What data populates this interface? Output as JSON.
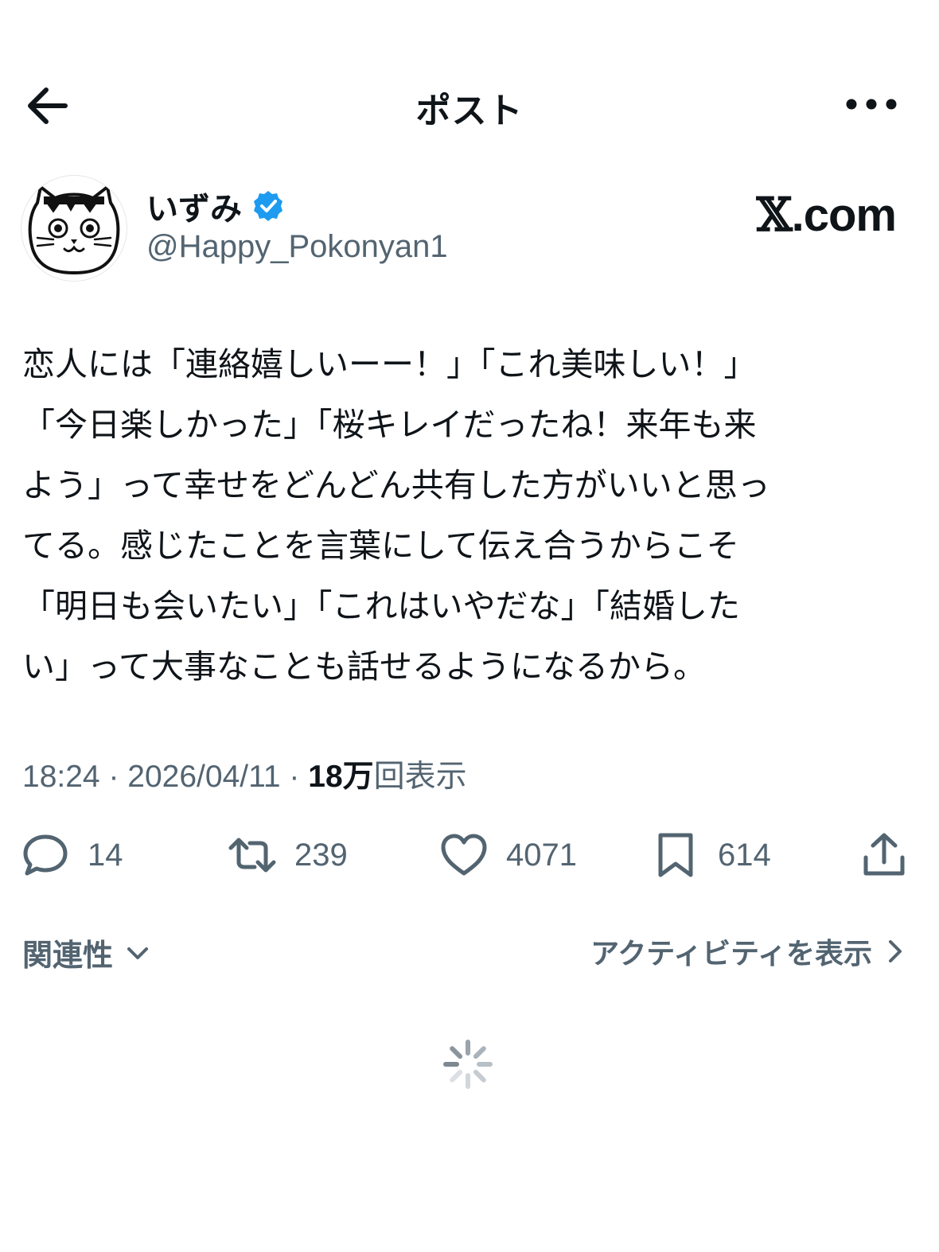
{
  "header": {
    "title": "ポスト",
    "back_icon": "arrow-left-icon",
    "more_icon": "more-horizontal-icon"
  },
  "author": {
    "display_name": "いずみ",
    "handle": "@Happy_Pokonyan1",
    "verified": true,
    "avatar_icon": "cat-face-avatar",
    "verified_color": "#1d9bf0"
  },
  "watermark": {
    "x_glyph": "𝕏",
    "domain": ".com"
  },
  "tweet": {
    "lines": [
      "恋人には「連絡嬉しいーー！」「これ美味しい！」",
      "「今日楽しかった」「桜キレイだったね！来年も来",
      "よう」って幸せをどんどん共有した方がいいと思っ",
      "てる。感じたことを言葉にして伝え合うからこそ",
      "「明日も会いたい」「これはいやだな」「結婚した",
      "い」って大事なことも話せるようになるから。"
    ]
  },
  "meta": {
    "time": "18:24",
    "separator": " · ",
    "date": "2026/04/11",
    "views_count": "18万",
    "views_label": "回表示"
  },
  "actions": {
    "reply_count": "14",
    "repost_count": "239",
    "like_count": "4071",
    "bookmark_count": "614"
  },
  "footer": {
    "relevance_label": "関連性",
    "activity_label": "アクティビティを表示"
  },
  "colors": {
    "text_primary": "#0f1419",
    "text_secondary": "#536471",
    "accent": "#1d9bf0"
  }
}
